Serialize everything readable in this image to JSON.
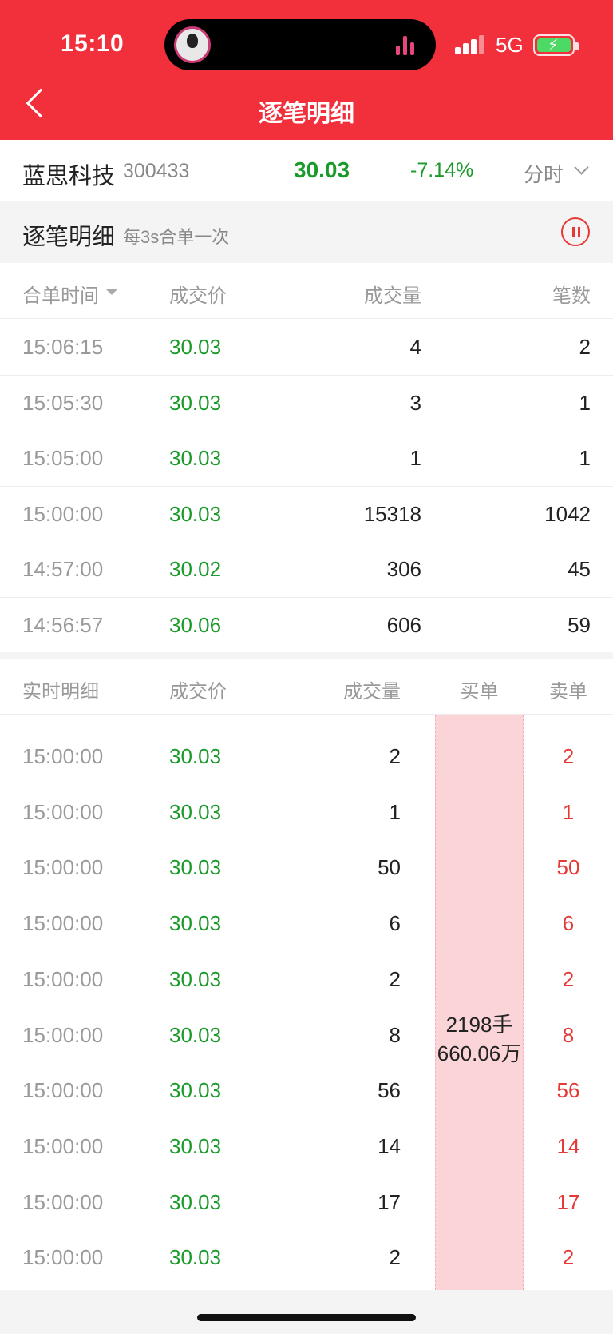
{
  "status_bar": {
    "time": "15:10",
    "network": "5G"
  },
  "nav": {
    "title": "逐笔明细"
  },
  "stock": {
    "name": "蓝思科技",
    "code": "300433",
    "price": "30.03",
    "change": "-7.14%",
    "period": "分时"
  },
  "merged_section": {
    "title": "逐笔明细",
    "subtitle": "每3s合单一次",
    "headers": {
      "time": "合单时间",
      "price": "成交价",
      "volume": "成交量",
      "count": "笔数"
    },
    "rows": [
      {
        "time": "15:06:15",
        "price": "30.03",
        "volume": "4",
        "count": "2"
      },
      {
        "time": "15:05:30",
        "price": "30.03",
        "volume": "3",
        "count": "1"
      },
      {
        "time": "15:05:00",
        "price": "30.03",
        "volume": "1",
        "count": "1"
      },
      {
        "time": "15:00:00",
        "price": "30.03",
        "volume": "15318",
        "count": "1042"
      },
      {
        "time": "14:57:00",
        "price": "30.02",
        "volume": "306",
        "count": "45"
      },
      {
        "time": "14:56:57",
        "price": "30.06",
        "volume": "606",
        "count": "59"
      }
    ]
  },
  "realtime_section": {
    "headers": {
      "title": "实时明细",
      "price": "成交价",
      "volume": "成交量",
      "buy": "买单",
      "sell": "卖单"
    },
    "buy_summary": {
      "lots": "2198手",
      "amount": "660.06万"
    },
    "rows": [
      {
        "time": "15:00:00",
        "price": "30.03",
        "volume": "2",
        "sell": "2"
      },
      {
        "time": "15:00:00",
        "price": "30.03",
        "volume": "1",
        "sell": "1"
      },
      {
        "time": "15:00:00",
        "price": "30.03",
        "volume": "50",
        "sell": "50"
      },
      {
        "time": "15:00:00",
        "price": "30.03",
        "volume": "6",
        "sell": "6"
      },
      {
        "time": "15:00:00",
        "price": "30.03",
        "volume": "2",
        "sell": "2"
      },
      {
        "time": "15:00:00",
        "price": "30.03",
        "volume": "8",
        "sell": "8"
      },
      {
        "time": "15:00:00",
        "price": "30.03",
        "volume": "56",
        "sell": "56"
      },
      {
        "time": "15:00:00",
        "price": "30.03",
        "volume": "14",
        "sell": "14"
      },
      {
        "time": "15:00:00",
        "price": "30.03",
        "volume": "17",
        "sell": "17"
      },
      {
        "time": "15:00:00",
        "price": "30.03",
        "volume": "2",
        "sell": "2"
      }
    ]
  },
  "colors": {
    "header_red": "#f2303b",
    "down_green": "#1a9a2a",
    "sell_red": "#e53935",
    "buy_highlight": "#fad4d6"
  },
  "icons": {
    "back": "chevron-left-icon",
    "period": "chevron-down-icon",
    "pause": "pause-icon"
  }
}
